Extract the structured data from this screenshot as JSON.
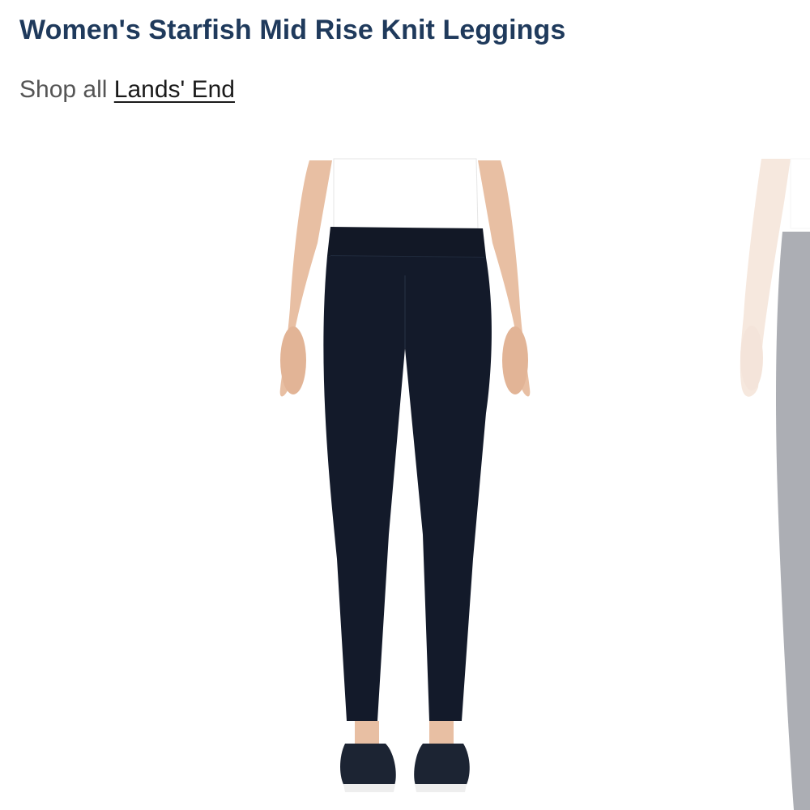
{
  "product": {
    "title": "Women's Starfish Mid Rise Knit Leggings"
  },
  "brand": {
    "prefix": "Shop all",
    "link_text": "Lands' End"
  },
  "gallery": {
    "images": [
      {
        "alt": "Women's Starfish Mid Rise Knit Leggings"
      },
      {
        "alt": "Women's Starfish Mid Rise Knit Leggings"
      }
    ]
  },
  "colors": {
    "title": "#1f3a5c",
    "legging": "#131a2a",
    "skin": "#e8bfa3"
  }
}
